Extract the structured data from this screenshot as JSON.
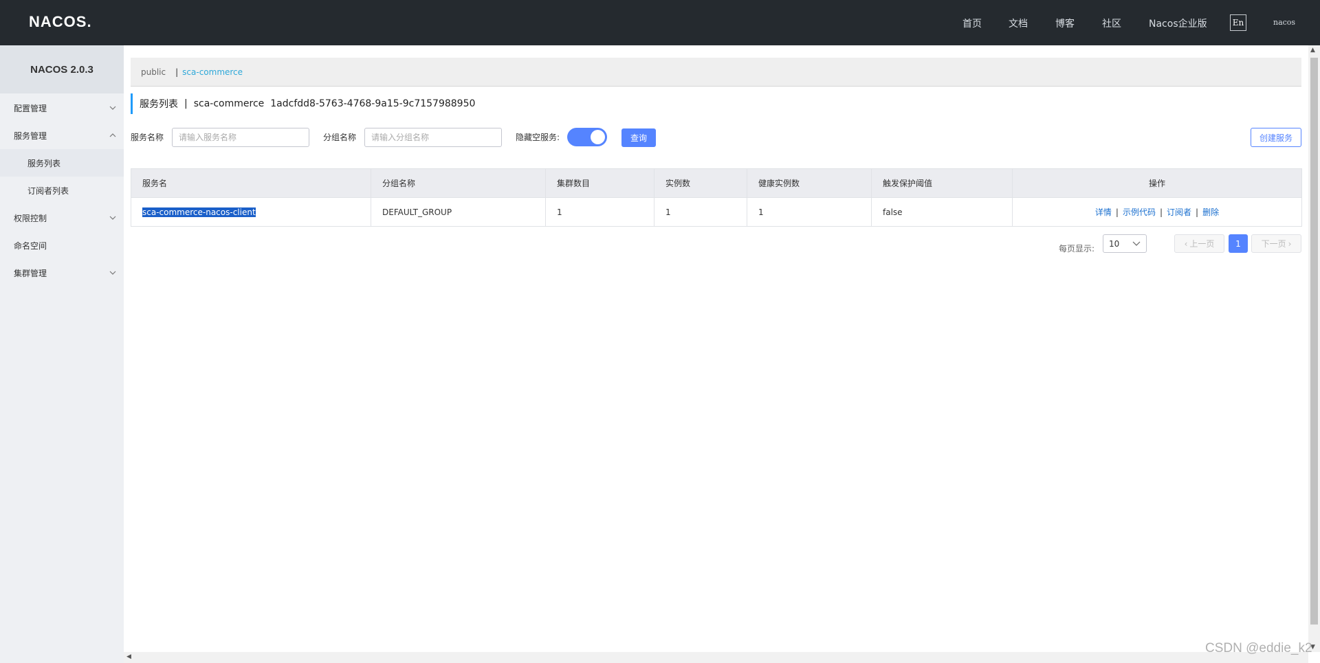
{
  "header": {
    "logo": "NACOS.",
    "nav": [
      "首页",
      "文档",
      "博客",
      "社区",
      "Nacos企业版"
    ],
    "lang": "En",
    "user": "nacos"
  },
  "sidebar": {
    "title": "NACOS 2.0.3",
    "items": [
      {
        "label": "配置管理"
      },
      {
        "label": "服务管理"
      },
      {
        "label": "服务列表"
      },
      {
        "label": "订阅者列表"
      },
      {
        "label": "权限控制"
      },
      {
        "label": "命名空间"
      },
      {
        "label": "集群管理"
      }
    ]
  },
  "namespace_bar": {
    "public": "public",
    "separator": "|",
    "active": "sca-commerce"
  },
  "page_header": {
    "title": "服务列表",
    "separator": "|",
    "namespace": "sca-commerce",
    "namespace_id": "1adcfdd8-5763-4768-9a15-9c7157988950"
  },
  "filters": {
    "service_name_label": "服务名称",
    "service_name_placeholder": "请输入服务名称",
    "group_name_label": "分组名称",
    "group_name_placeholder": "请输入分组名称",
    "hide_empty_label": "隐藏空服务:",
    "query_button": "查询",
    "create_button": "创建服务"
  },
  "table": {
    "headers": [
      "服务名",
      "分组名称",
      "集群数目",
      "实例数",
      "健康实例数",
      "触发保护阈值",
      "操作"
    ],
    "rows": [
      {
        "service": "sca-commerce-nacos-client",
        "group": "DEFAULT_GROUP",
        "clusters": "1",
        "instances": "1",
        "healthy": "1",
        "threshold": "false",
        "ops": [
          "详情",
          "示例代码",
          "订阅者",
          "删除"
        ]
      }
    ]
  },
  "pagination": {
    "per_page_label": "每页显示:",
    "per_page_value": "10",
    "prev": "上一页",
    "page": "1",
    "next": "下一页"
  },
  "watermark": "CSDN @eddie_k2"
}
